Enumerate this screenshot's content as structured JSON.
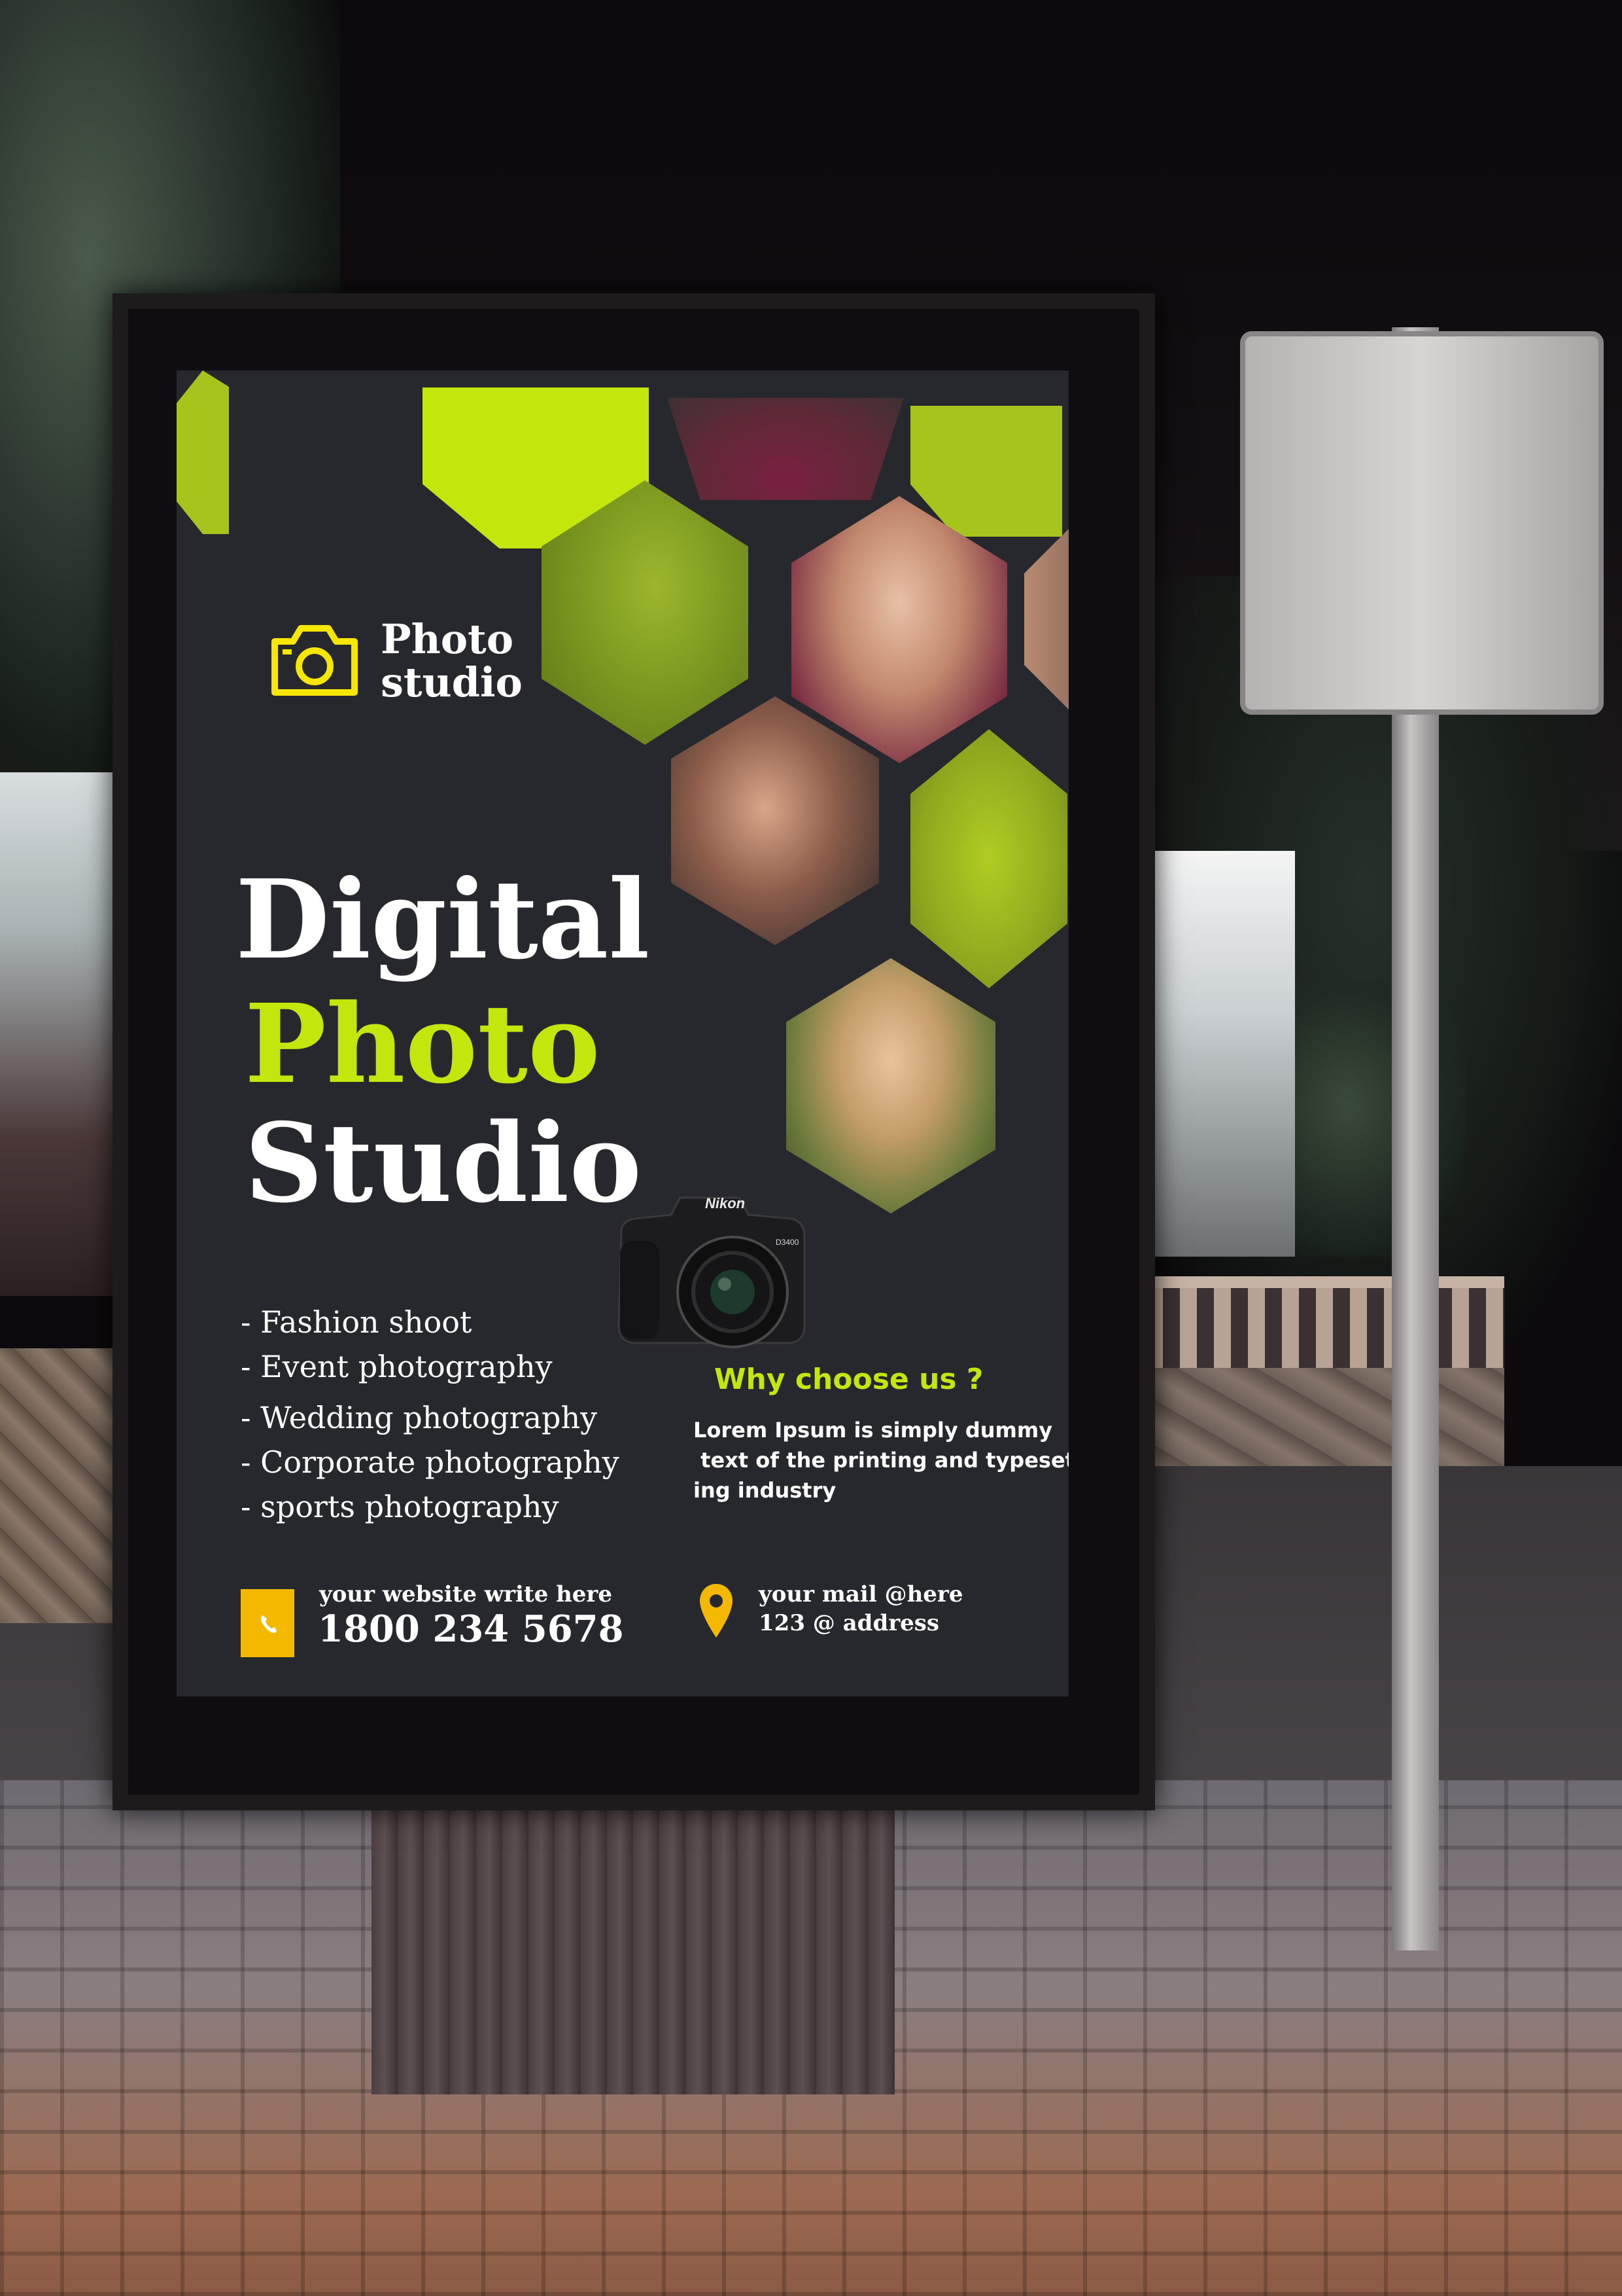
{
  "poster": {
    "logo": {
      "line1": "Photo",
      "line2": "studio",
      "icon": "camera-icon"
    },
    "headline": {
      "line1": "Digital",
      "line2": "Photo",
      "line3": "Studio"
    },
    "services": [
      "- Fashion shoot",
      "- Event photography",
      "- Wedding photography",
      "- Corporate photography",
      "- sports photography"
    ],
    "why": {
      "title": "Why choose us ?",
      "text": "Lorem Ipsum is simply dummy\n text of the printing and typesett\ning industry"
    },
    "contact": {
      "website": "your website write here",
      "phone": "1800 234 5678",
      "mail": "your mail @here",
      "address": "123 @ address",
      "phone_icon": "phone-icon",
      "location_icon": "map-pin-icon"
    },
    "camera_brand": "Nikon",
    "camera_model": "D3400",
    "colors": {
      "background": "#27272e",
      "accent": "#c3e70c",
      "logo": "#f7e600",
      "badge": "#f5b800"
    }
  }
}
